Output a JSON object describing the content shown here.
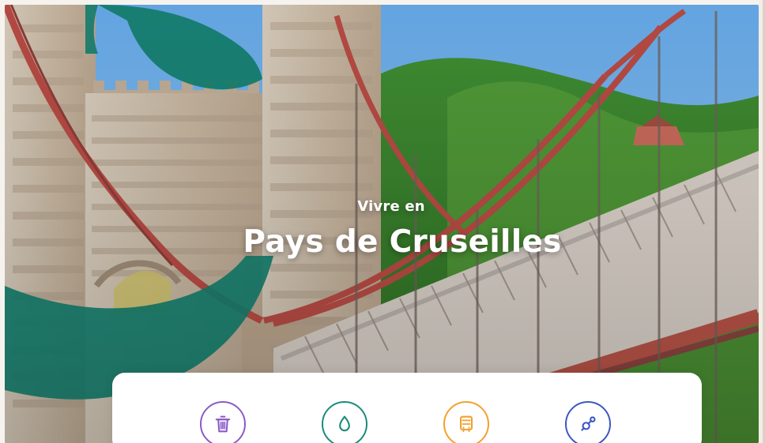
{
  "hero": {
    "kicker": "Vivre en",
    "title": "Pays de Cruseilles"
  },
  "services": [
    {
      "icon": "trash-icon",
      "color": "#8b5bc7"
    },
    {
      "icon": "water-drop-icon",
      "color": "#1d8a7b"
    },
    {
      "icon": "bus-icon",
      "color": "#f2a12f"
    },
    {
      "icon": "pacifier-icon",
      "color": "#3c58bf"
    }
  ],
  "colors": {
    "brand_green": "#14806f",
    "sky": "#78b8ef",
    "forest": "#4e8a34",
    "bridge_red": "#b2463f",
    "stone": "#c9b9a4"
  }
}
